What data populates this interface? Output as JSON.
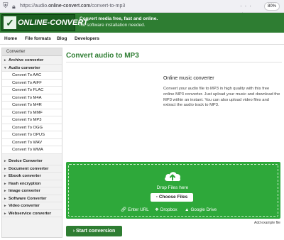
{
  "browser": {
    "url_prefix": "https://audio.",
    "url_domain": "online-convert.com",
    "url_path": "/convert-to-mp3",
    "icons": "··· ☆",
    "zoom": "80%"
  },
  "header": {
    "logo_mark": "✓",
    "logo_text": "ONLINE-CONVERT",
    "tagline_1": "Convert media free, fast and online.",
    "tagline_2": "No software installation needed."
  },
  "nav": {
    "items": [
      "Home",
      "File formats",
      "Blog",
      "Developers"
    ]
  },
  "sidebar": {
    "heading": "Converter",
    "audio_category": "Audio converter",
    "audio_items": [
      "Convert To AAC",
      "Convert To AIFF",
      "Convert To FLAC",
      "Convert To M4A",
      "Convert To M4R",
      "Convert To MMF",
      "Convert To MP3",
      "Convert To OGG",
      "Convert To OPUS",
      "Convert To WAV",
      "Convert To WMA"
    ],
    "archive_category": "Archive converter",
    "categories": [
      "Device Converter",
      "Document converter",
      "Ebook converter",
      "Hash encryption",
      "Image converter",
      "Software Converter",
      "Video converter",
      "Webservice converter"
    ]
  },
  "main": {
    "title": "Convert audio to MP3",
    "subtitle": "Online music converter",
    "description": "Convert your audio file to MP3 in high quality with this free online MP3 converter. Just upload your music and download the MP3 within an instant. You can also upload video files and extract the audio track to MP3.",
    "upload": {
      "drop_text": "Drop Files here",
      "choose_label": "Choose Files",
      "choose_icon": "▫",
      "enter_url": "Enter URL",
      "dropbox": "Dropbox",
      "google_drive": "Google Drive",
      "colors": {
        "background": "#2ea83a"
      }
    },
    "example_link": "Add example file",
    "start_label": "Start conversion",
    "start_icon": "›"
  },
  "colors": {
    "brand_green": "#2e7d32"
  }
}
